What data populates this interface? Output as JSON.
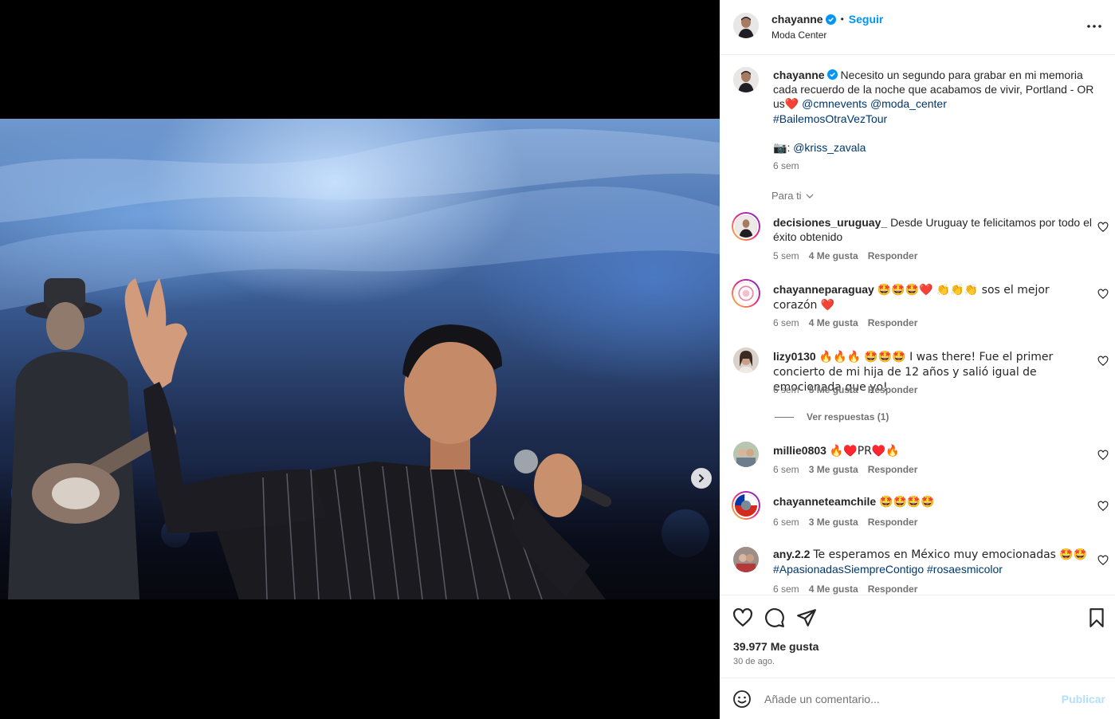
{
  "header": {
    "username": "chayanne",
    "separator": "•",
    "follow_label": "Seguir",
    "location": "Moda Center"
  },
  "caption": {
    "username": "chayanne",
    "text_line1": "Necesito un segundo para grabar en mi memoria",
    "text_line2": "cada recuerdo de la noche que acabamos de vivir, Portland - OR",
    "text_line3_prefix": "us",
    "heart": "❤️",
    "mention1": "@cmnevents",
    "mention2": "@moda_center",
    "hashtag": "#BailemosOtraVezTour",
    "camera": "📷",
    "photo_credit_sep": ":",
    "photo_credit": "@kriss_zavala",
    "time": "6 sem"
  },
  "filter": {
    "label": "Para ti"
  },
  "comments": [
    {
      "username": "decisiones_uruguay_",
      "text": "Desde Uruguay te felicitamos por todo el éxito obtenido",
      "time": "5 sem",
      "likes": "4 Me gusta",
      "reply": "Responder"
    },
    {
      "username": "chayanneparaguay",
      "text": "🤩🤩🤩❤️ 👏👏👏 sos el mejor corazón ❤️",
      "time": "6 sem",
      "likes": "4 Me gusta",
      "reply": "Responder"
    },
    {
      "username": "lizy0130",
      "text": "🔥🔥🔥 🤩🤩🤩 I was there! Fue el primer concierto de mi hija de 12 años y salió igual de emocionada que yo!",
      "time": "6 sem",
      "likes": "5 Me gusta",
      "reply": "Responder"
    },
    {
      "username": "millie0803",
      "text": "🔥♥️PR♥️🔥",
      "time": "6 sem",
      "likes": "3 Me gusta",
      "reply": "Responder"
    },
    {
      "username": "chayanneteamchile",
      "text": "🤩🤩🤩🤩",
      "time": "6 sem",
      "likes": "3 Me gusta",
      "reply": "Responder"
    },
    {
      "username": "any.2.2",
      "text": "Te esperamos en México muy emocionadas 🤩🤩",
      "hashtags": "#ApasionadasSiempreContigo #rosaesmicolor",
      "time": "6 sem",
      "likes": "4 Me gusta",
      "reply": "Responder"
    }
  ],
  "view_replies": "Ver respuestas (1)",
  "stats": {
    "likes": "39.977 Me gusta",
    "date": "30 de ago."
  },
  "composer": {
    "placeholder": "Añade un comentario...",
    "publish": "Publicar"
  },
  "carousel": {
    "count": 4,
    "active": 0
  },
  "colors": {
    "link": "#00376b",
    "accent": "#0095f6",
    "muted": "#737373",
    "publish_disabled": "#b2dffc"
  }
}
